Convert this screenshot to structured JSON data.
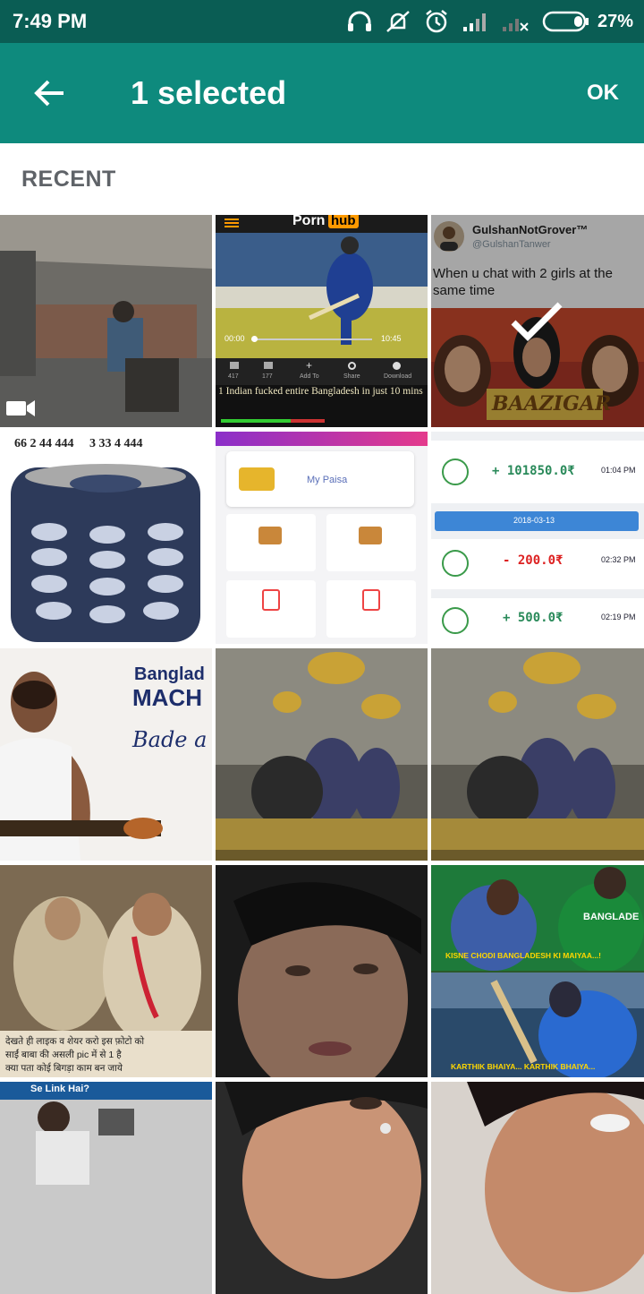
{
  "status_bar": {
    "time": "7:49 PM",
    "battery_percent": "27%",
    "icons": [
      "headset-icon",
      "vibrate-icon",
      "alarm-icon",
      "signal-icon",
      "no-signal-icon",
      "battery-icon"
    ]
  },
  "app_bar": {
    "title": "1 selected",
    "ok_label": "OK",
    "back_icon": "arrow-back-icon"
  },
  "section": {
    "label": "RECENT"
  },
  "colors": {
    "status_bar": "#0a5d54",
    "app_bar": "#0e8a7d"
  },
  "tiles": [
    {
      "id": "cctv-video",
      "type": "video",
      "selected": false
    },
    {
      "id": "porn-meme",
      "type": "image",
      "selected": false,
      "brand": "Porn",
      "brand_badge": "hub",
      "video_start": "00:00",
      "video_end": "10:45",
      "stat_likes": "417",
      "stat_dislikes": "177",
      "action_add": "Add To",
      "action_share": "Share",
      "action_download": "Download",
      "caption": "1 Indian fucked entire Bangladesh in just 10 mins"
    },
    {
      "id": "tweet-meme",
      "type": "image",
      "selected": true,
      "author": "GulshanNotGrover™",
      "handle": "@GulshanTanwer",
      "text": "When u chat with 2 girls at the same time",
      "movie": "BAAZIGAR"
    },
    {
      "id": "nokia-meme",
      "type": "image",
      "selected": false,
      "top_text": "66 2 44 444     3 33 4 444"
    },
    {
      "id": "app-screen",
      "type": "image",
      "selected": false,
      "title": "My Paisa"
    },
    {
      "id": "transactions",
      "type": "image",
      "selected": false,
      "tx1": "+ 101850.0₹",
      "tx1_time": "01:04 PM",
      "date": "2018-03-13",
      "tx2": "- 200.0₹",
      "tx2_time": "02:32 PM",
      "tx3": "+ 500.0₹",
      "tx3_time": "02:19 PM"
    },
    {
      "id": "ad-guitar",
      "type": "image",
      "selected": false,
      "line1": "Banglad",
      "line2": "MACH",
      "line3": "Bade a"
    },
    {
      "id": "idol-1",
      "type": "image",
      "selected": false
    },
    {
      "id": "idol-2",
      "type": "image",
      "selected": false
    },
    {
      "id": "sai-baba",
      "type": "image",
      "selected": false,
      "caption_l1": "देखते ही लाइक व शेयर करो इस फ़ोटो को",
      "caption_l2": "साईं बाबा की असली pic में से 1 है",
      "caption_l3": "क्या पता कोई बिगड़ा काम बन जाये"
    },
    {
      "id": "selfie-1",
      "type": "image",
      "selected": false
    },
    {
      "id": "cricket-meme",
      "type": "image",
      "selected": false,
      "caption1": "KISNE CHODI BANGLADESH KI MAIYAA...!",
      "caption2": "KARTHIK BHAIYA... KARTHIK BHAIYA...",
      "jersey": "BANGLADE"
    },
    {
      "id": "office-meme",
      "type": "image",
      "selected": false,
      "tag": "Se Link Hai?"
    },
    {
      "id": "selfie-2",
      "type": "image",
      "selected": false
    },
    {
      "id": "selfie-3",
      "type": "image",
      "selected": false
    }
  ]
}
